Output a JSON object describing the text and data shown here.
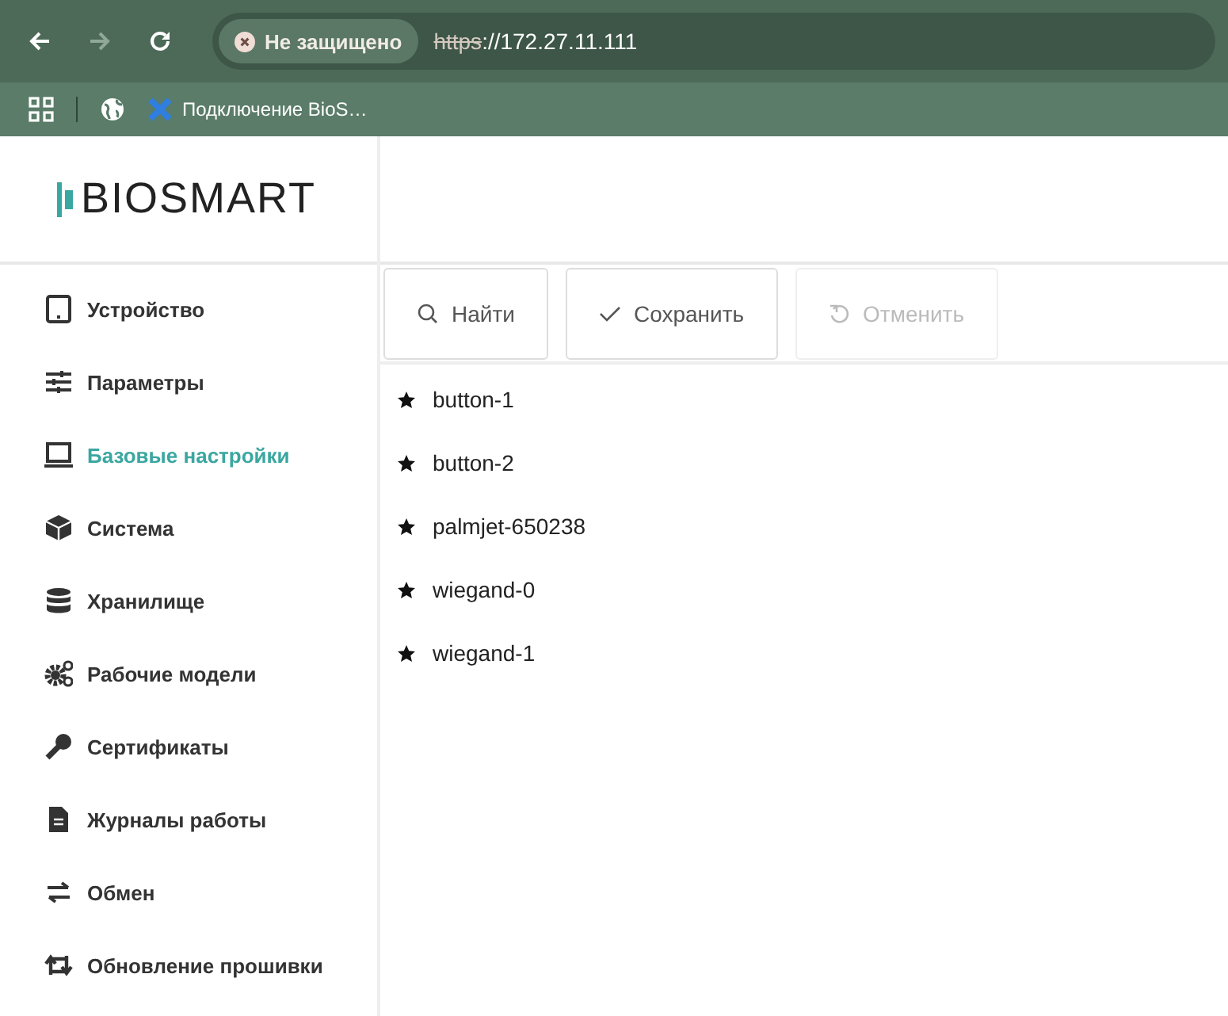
{
  "browser": {
    "security_label": "Не защищено",
    "url_scheme": "https",
    "url_rest": "://172.27.11.111",
    "forward_disabled": true,
    "bookmarks": [
      {
        "label": "Подключение BioS…"
      }
    ]
  },
  "logo": {
    "text": "BIOSMART"
  },
  "sidebar": {
    "items": [
      {
        "label": "Устройство",
        "selected": false
      },
      {
        "label": "Параметры",
        "selected": false
      },
      {
        "label": "Базовые настройки",
        "selected": true
      },
      {
        "label": "Система",
        "selected": false
      },
      {
        "label": "Хранилище",
        "selected": false
      },
      {
        "label": "Рабочие модели",
        "selected": false
      },
      {
        "label": "Сертификаты",
        "selected": false
      },
      {
        "label": "Журналы работы",
        "selected": false
      },
      {
        "label": "Обмен",
        "selected": false
      },
      {
        "label": "Обновление прошивки",
        "selected": false
      }
    ]
  },
  "toolbar": {
    "buttons": [
      {
        "label": "Найти",
        "disabled": false
      },
      {
        "label": "Сохранить",
        "disabled": false
      },
      {
        "label": "Отменить",
        "disabled": true
      }
    ]
  },
  "list": {
    "items": [
      {
        "label": "button-1"
      },
      {
        "label": "button-2"
      },
      {
        "label": "palmjet-650238"
      },
      {
        "label": "wiegand-0"
      },
      {
        "label": "wiegand-1"
      }
    ]
  }
}
